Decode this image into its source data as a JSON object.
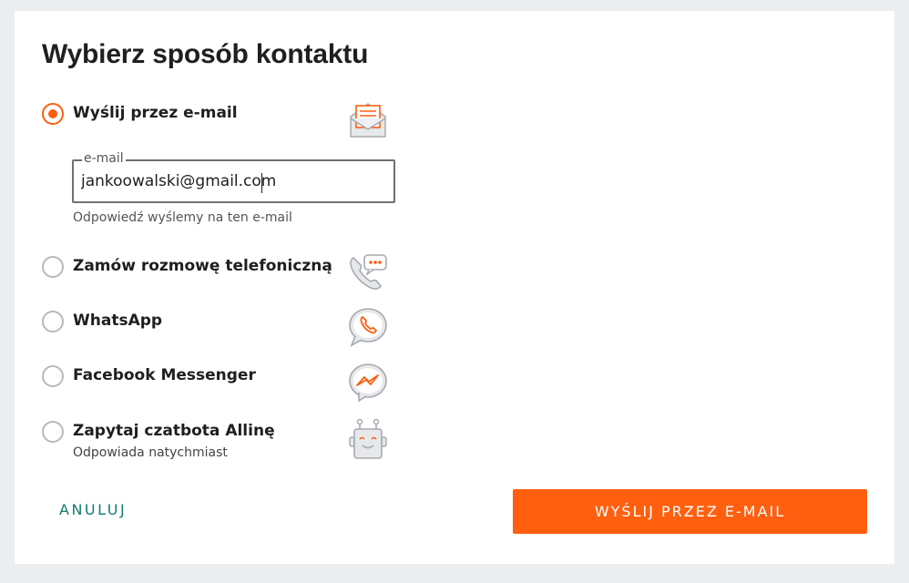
{
  "dialog": {
    "title": "Wybierz sposób kontaktu"
  },
  "options": [
    {
      "label": "Wyślij przez e-mail",
      "selected": true,
      "icon": "envelope-icon"
    },
    {
      "label": "Zamów rozmowę telefoniczną",
      "selected": false,
      "icon": "phone-chat-icon"
    },
    {
      "label": "WhatsApp",
      "selected": false,
      "icon": "whatsapp-icon"
    },
    {
      "label": "Facebook Messenger",
      "selected": false,
      "icon": "messenger-icon"
    },
    {
      "label": "Zapytaj czatbota Allinę",
      "sublabel": "Odpowiada natychmiast",
      "selected": false,
      "icon": "chatbot-icon"
    }
  ],
  "email_field": {
    "legend": "e-mail",
    "value": "jankoowalski@gmail.com",
    "helper": "Odpowiedź wyślemy na ten e-mail"
  },
  "actions": {
    "cancel_label": "ANULUJ",
    "submit_label": "WYŚLIJ PRZEZ E-MAIL"
  },
  "colors": {
    "accent": "#ff5f0f",
    "cancel_text": "#147a6e",
    "page_bg": "#ebedef"
  }
}
